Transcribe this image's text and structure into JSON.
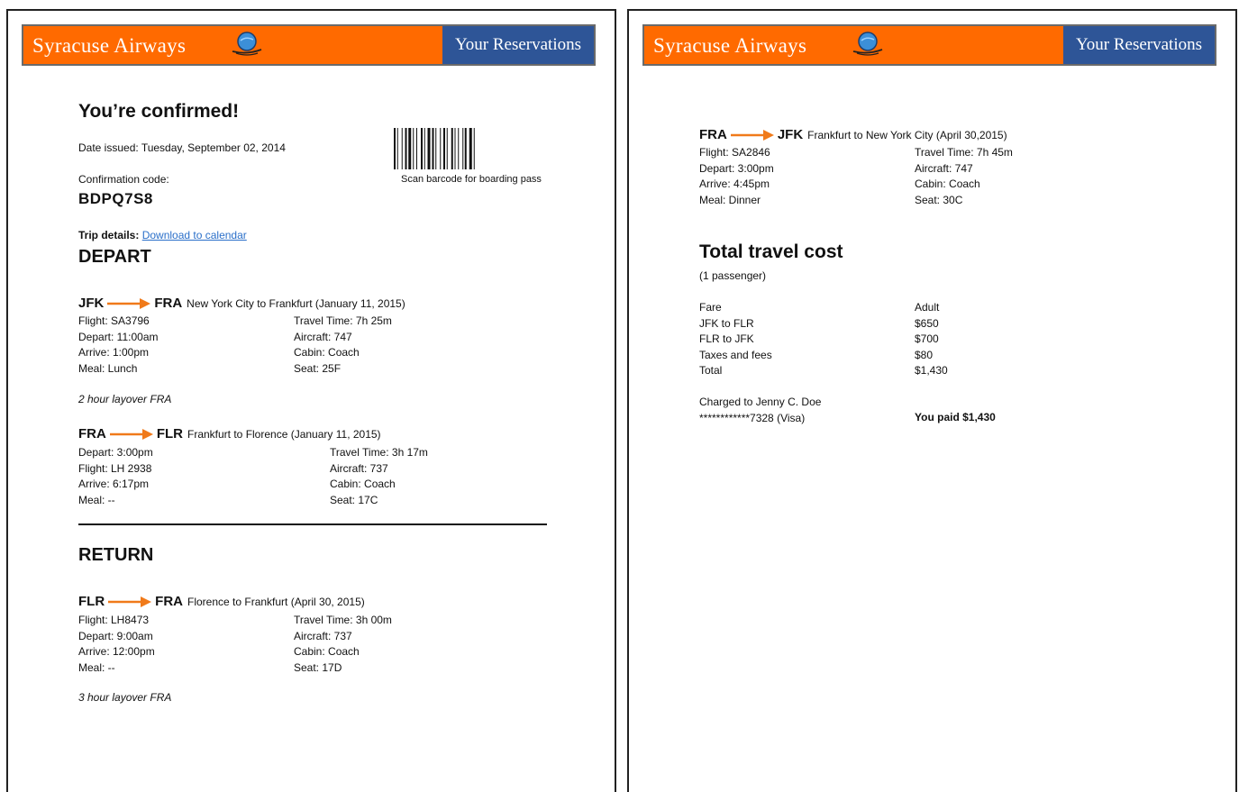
{
  "header": {
    "airline": "Syracuse Airways",
    "reservations": "Your Reservations",
    "colors": {
      "banner": "#ff6a00",
      "reservations_bg": "#2e5597",
      "link": "#2a6fc9"
    }
  },
  "page1": {
    "title": "You’re confirmed!",
    "date_issued": "Date issued: Tuesday, September 02, 2014",
    "barcode_caption": "Scan barcode for boarding pass",
    "confirmation_label": "Confirmation code:",
    "confirmation_code": "BDPQ7S8",
    "trip_details_label": "Trip details:",
    "download_link": "Download to calendar",
    "depart_heading": "DEPART",
    "return_heading": "RETURN",
    "depart_legs": [
      {
        "from": "JFK",
        "to": "FRA",
        "description": "New York City to Frankfurt (January 11, 2015)",
        "left": [
          "Flight: SA3796",
          "Depart: 11:00am",
          "Arrive: 1:00pm",
          "Meal: Lunch"
        ],
        "right": [
          "Travel Time: 7h 25m",
          "Aircraft: 747",
          "Cabin: Coach",
          "Seat: 25F"
        ],
        "layover": "2 hour layover FRA"
      },
      {
        "from": "FRA",
        "to": "FLR",
        "description": "Frankfurt to Florence (January 11, 2015)",
        "left": [
          "Depart: 3:00pm",
          "Flight: LH 2938",
          "Arrive: 6:17pm",
          "Meal: --"
        ],
        "right": [
          "Travel Time: 3h 17m",
          "Aircraft: 737",
          "Cabin: Coach",
          "Seat: 17C"
        ]
      }
    ],
    "return_legs": [
      {
        "from": "FLR",
        "to": "FRA",
        "description": "Florence to Frankfurt (April 30, 2015)",
        "left": [
          "Flight: LH8473",
          "Depart: 9:00am",
          "Arrive: 12:00pm",
          "Meal: --"
        ],
        "right": [
          "Travel Time: 3h 00m",
          "Aircraft: 737",
          "Cabin: Coach",
          "Seat: 17D"
        ],
        "layover": "3 hour layover FRA"
      }
    ]
  },
  "page2": {
    "leg": {
      "from": "FRA",
      "to": "JFK",
      "description": "Frankfurt to New York City (April 30,2015)",
      "left": [
        "Flight: SA2846",
        "Depart: 3:00pm",
        "Arrive: 4:45pm",
        "Meal: Dinner"
      ],
      "right": [
        "Travel Time: 7h 45m",
        "Aircraft: 747",
        "Cabin: Coach",
        "Seat: 30C"
      ]
    },
    "cost_heading": "Total travel cost",
    "passengers": "(1 passenger)",
    "cost_labels": [
      "Fare",
      "JFK to FLR",
      "FLR to JFK",
      "Taxes and fees",
      "Total"
    ],
    "cost_values": [
      "Adult",
      "$650",
      "$700",
      "$80",
      "$1,430"
    ],
    "charged_to": "Charged to Jenny C. Doe",
    "card": "************7328 (Visa)",
    "paid": "You paid $1,430"
  }
}
